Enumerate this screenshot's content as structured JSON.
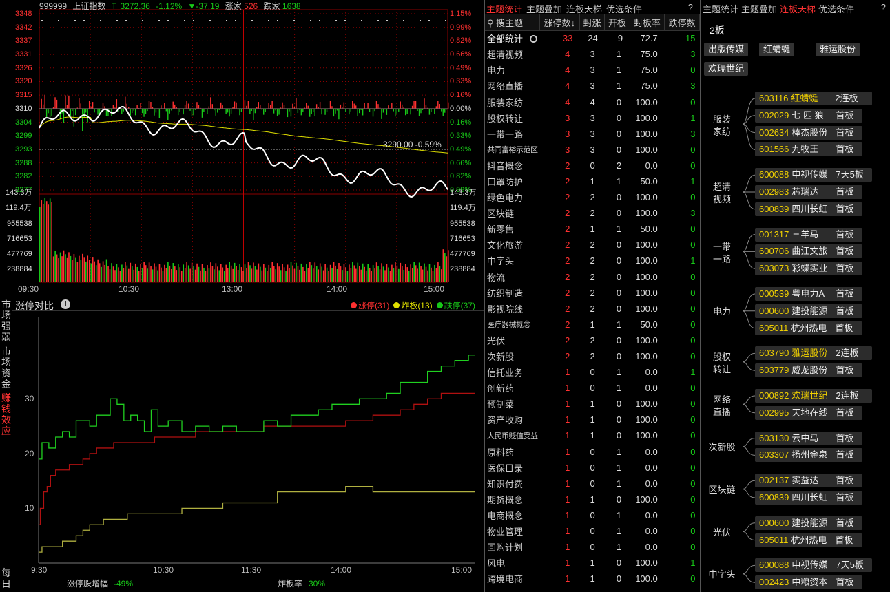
{
  "index": {
    "code": "999999",
    "name": "上证指数",
    "t": "T",
    "price": "3272.36",
    "pct": "-1.12%",
    "chg": "▼-37.19",
    "up_label": "涨家",
    "up": "526",
    "dn_label": "跌家",
    "dn": "1638",
    "left_prices": [
      "3348",
      "3342",
      "3337",
      "3331",
      "3326",
      "3320",
      "3315",
      "3310",
      "3304",
      "3299",
      "3293",
      "3288",
      "3282",
      "3277"
    ],
    "right_pcts": [
      "1.15%",
      "0.99%",
      "0.82%",
      "0.66%",
      "0.49%",
      "0.33%",
      "0.16%",
      "0.00%",
      "0.16%",
      "0.33%",
      "0.49%",
      "0.66%",
      "0.82%",
      "0.99%"
    ],
    "vol_labels": [
      "143.3万",
      "119.4万",
      "955538",
      "716653",
      "477769",
      "238884"
    ],
    "times": [
      "09:30",
      "10:30",
      "13:00",
      "14:00",
      "15:00"
    ],
    "cursor_label": "3290.00 -0.59%"
  },
  "breadth": {
    "side_tabs": [
      {
        "label": "市场强弱",
        "active": false
      },
      {
        "label": "市场资金",
        "active": false
      },
      {
        "label": "赚钱效应",
        "active": true
      },
      {
        "label": "每日",
        "active": false
      }
    ],
    "title": "涨停对比",
    "legend": [
      {
        "label": "涨停(31)",
        "color": "#ff3030"
      },
      {
        "label": "炸板(13)",
        "color": "#e0e000"
      },
      {
        "label": "跌停(37)",
        "color": "#18c818"
      }
    ],
    "yticks": [
      "30",
      "20",
      "10"
    ],
    "xticks": [
      "9:30",
      "10:30",
      "11:30",
      "14:00",
      "15:00"
    ],
    "foot1_label": "涨停股增幅",
    "foot1_val": "-49%",
    "foot2_label": "炸板率",
    "foot2_val": "30%"
  },
  "chart_data": {
    "type": "line",
    "xlabel": "",
    "ylabel": "",
    "ylim": [
      0,
      45
    ],
    "series": [
      {
        "name": "涨停(31)",
        "color": "#ff3030",
        "x": [
          0,
          5,
          10,
          15,
          20,
          30,
          40,
          50,
          60,
          70,
          80,
          90,
          100,
          120,
          140,
          160,
          180,
          200,
          220,
          240,
          260,
          280,
          300,
          320,
          340,
          360,
          380,
          400,
          420,
          440,
          460,
          480,
          500,
          520,
          540,
          560,
          580,
          600,
          620,
          640
        ],
        "values": [
          7,
          10,
          13,
          14,
          16,
          17,
          17,
          18,
          18,
          19,
          20,
          21,
          21,
          22,
          22,
          22,
          23,
          23,
          23,
          24,
          24,
          24,
          24,
          24,
          25,
          25,
          25,
          25,
          25,
          25,
          26,
          26,
          27,
          27,
          28,
          29,
          30,
          31,
          31,
          31
        ]
      },
      {
        "name": "炸板(13)",
        "color": "#e0e000",
        "x": [
          0,
          10,
          20,
          30,
          40,
          50,
          60,
          70,
          80,
          90,
          100,
          120,
          140,
          160,
          180,
          200,
          220,
          240,
          260,
          280,
          300,
          320,
          340,
          360,
          380,
          400,
          420,
          440,
          460,
          480,
          500,
          520,
          540,
          560,
          580,
          600,
          620,
          640
        ],
        "values": [
          2,
          3,
          3,
          3,
          4,
          4,
          5,
          6,
          7,
          7,
          8,
          8,
          9,
          9,
          9,
          9,
          10,
          10,
          10,
          11,
          11,
          11,
          11,
          13,
          13,
          13,
          13,
          13,
          14,
          14,
          13,
          13,
          13,
          13,
          13,
          13,
          13,
          13
        ]
      },
      {
        "name": "跌停(37)",
        "color": "#18c818",
        "x": [
          0,
          10,
          20,
          30,
          40,
          50,
          60,
          70,
          80,
          90,
          100,
          110,
          120,
          130,
          140,
          150,
          160,
          170,
          180,
          200,
          220,
          240,
          260,
          280,
          300,
          320,
          340,
          360,
          380,
          400,
          420,
          440,
          460,
          480,
          500,
          520,
          540,
          560,
          580,
          600,
          620,
          640
        ],
        "values": [
          19,
          22,
          21,
          23,
          24,
          23,
          26,
          26,
          25,
          27,
          27,
          30,
          29,
          26,
          27,
          26,
          24,
          28,
          25,
          26,
          24,
          25,
          24,
          25,
          24,
          24,
          26,
          25,
          27,
          27,
          28,
          29,
          29,
          30,
          30,
          31,
          33,
          33,
          35,
          36,
          37,
          38
        ]
      }
    ]
  },
  "themes": {
    "tabs": [
      {
        "label": "主题统计",
        "active": true
      },
      {
        "label": "主题叠加",
        "active": false
      },
      {
        "label": "连板天梯",
        "active": false
      },
      {
        "label": "优选条件",
        "active": false
      },
      {
        "label": "?",
        "active": false
      }
    ],
    "search": "搜主题",
    "cols": [
      "涨停数↓",
      "封涨",
      "开板",
      "封板率",
      "跌停数"
    ],
    "total": {
      "name": "全部统计",
      "a": "33",
      "b": "24",
      "c": "9",
      "d": "72.7",
      "e": "15"
    },
    "rows": [
      [
        "超清视频",
        "4",
        "3",
        "1",
        "75.0",
        "3"
      ],
      [
        "电力",
        "4",
        "3",
        "1",
        "75.0",
        "0"
      ],
      [
        "网络直播",
        "4",
        "3",
        "1",
        "75.0",
        "3"
      ],
      [
        "服装家纺",
        "4",
        "4",
        "0",
        "100.0",
        "0"
      ],
      [
        "股权转让",
        "3",
        "3",
        "0",
        "100.0",
        "1"
      ],
      [
        "一带一路",
        "3",
        "3",
        "0",
        "100.0",
        "3"
      ],
      [
        "共同富裕示范区",
        "3",
        "3",
        "0",
        "100.0",
        "0"
      ],
      [
        "抖音概念",
        "2",
        "0",
        "2",
        "0.0",
        "0"
      ],
      [
        "口罩防护",
        "2",
        "1",
        "1",
        "50.0",
        "1"
      ],
      [
        "绿色电力",
        "2",
        "2",
        "0",
        "100.0",
        "0"
      ],
      [
        "区块链",
        "2",
        "2",
        "0",
        "100.0",
        "3"
      ],
      [
        "新零售",
        "2",
        "1",
        "1",
        "50.0",
        "0"
      ],
      [
        "文化旅游",
        "2",
        "2",
        "0",
        "100.0",
        "0"
      ],
      [
        "中字头",
        "2",
        "2",
        "0",
        "100.0",
        "1"
      ],
      [
        "物流",
        "2",
        "2",
        "0",
        "100.0",
        "0"
      ],
      [
        "纺织制造",
        "2",
        "2",
        "0",
        "100.0",
        "0"
      ],
      [
        "影视院线",
        "2",
        "2",
        "0",
        "100.0",
        "0"
      ],
      [
        "医疗器械概念",
        "2",
        "1",
        "1",
        "50.0",
        "0"
      ],
      [
        "光伏",
        "2",
        "2",
        "0",
        "100.0",
        "0"
      ],
      [
        "次新股",
        "2",
        "2",
        "0",
        "100.0",
        "0"
      ],
      [
        "信托业务",
        "1",
        "0",
        "1",
        "0.0",
        "1"
      ],
      [
        "创新药",
        "1",
        "0",
        "1",
        "0.0",
        "0"
      ],
      [
        "预制菜",
        "1",
        "1",
        "0",
        "100.0",
        "0"
      ],
      [
        "资产收购",
        "1",
        "1",
        "0",
        "100.0",
        "0"
      ],
      [
        "人民币贬值受益",
        "1",
        "1",
        "0",
        "100.0",
        "0"
      ],
      [
        "原料药",
        "1",
        "0",
        "1",
        "0.0",
        "0"
      ],
      [
        "医保目录",
        "1",
        "0",
        "1",
        "0.0",
        "0"
      ],
      [
        "知识付费",
        "1",
        "0",
        "1",
        "0.0",
        "0"
      ],
      [
        "期货概念",
        "1",
        "1",
        "0",
        "100.0",
        "0"
      ],
      [
        "电商概念",
        "1",
        "0",
        "1",
        "0.0",
        "0"
      ],
      [
        "物业管理",
        "1",
        "0",
        "1",
        "0.0",
        "0"
      ],
      [
        "回购计划",
        "1",
        "0",
        "1",
        "0.0",
        "0"
      ],
      [
        "风电",
        "1",
        "1",
        "0",
        "100.0",
        "1"
      ],
      [
        "跨境电商",
        "1",
        "1",
        "0",
        "100.0",
        "0"
      ]
    ]
  },
  "ladder": {
    "tabs": [
      {
        "label": "主题统计",
        "active": false
      },
      {
        "label": "主题叠加",
        "active": false
      },
      {
        "label": "连板天梯",
        "active": true
      },
      {
        "label": "优选条件",
        "active": false
      },
      {
        "label": "?",
        "active": false
      }
    ],
    "level": "2板",
    "top": [
      "出版传媒",
      "红蜻蜓",
      "雅运股份",
      "欢瑞世纪"
    ],
    "groups": [
      {
        "sector": "服装家纺",
        "stocks": [
          {
            "code": "603116",
            "name": "红蜻蜓",
            "board": "2连板",
            "hl": true
          },
          {
            "code": "002029",
            "name": "七 匹 狼",
            "board": "首板",
            "hl": false
          },
          {
            "code": "002634",
            "name": "棒杰股份",
            "board": "首板",
            "hl": false
          },
          {
            "code": "601566",
            "name": "九牧王",
            "board": "首板",
            "hl": false
          }
        ]
      },
      {
        "sector": "超清视频",
        "stocks": [
          {
            "code": "600088",
            "name": "中视传媒",
            "board": "7天5板",
            "hl": false
          },
          {
            "code": "002983",
            "name": "芯瑞达",
            "board": "首板",
            "hl": false
          },
          {
            "code": "600839",
            "name": "四川长虹",
            "board": "首板",
            "hl": false
          }
        ]
      },
      {
        "sector": "一带一路",
        "stocks": [
          {
            "code": "001317",
            "name": "三羊马",
            "board": "首板",
            "hl": false
          },
          {
            "code": "600706",
            "name": "曲江文旅",
            "board": "首板",
            "hl": false
          },
          {
            "code": "603073",
            "name": "彩蝶实业",
            "board": "首板",
            "hl": false
          }
        ]
      },
      {
        "sector": "电力",
        "stocks": [
          {
            "code": "000539",
            "name": "粤电力A",
            "board": "首板",
            "hl": false
          },
          {
            "code": "000600",
            "name": "建投能源",
            "board": "首板",
            "hl": false
          },
          {
            "code": "605011",
            "name": "杭州热电",
            "board": "首板",
            "hl": false
          }
        ]
      },
      {
        "sector": "股权转让",
        "stocks": [
          {
            "code": "603790",
            "name": "雅运股份",
            "board": "2连板",
            "hl": true
          },
          {
            "code": "603779",
            "name": "威龙股份",
            "board": "首板",
            "hl": false
          }
        ]
      },
      {
        "sector": "网络直播",
        "stocks": [
          {
            "code": "000892",
            "name": "欢瑞世纪",
            "board": "2连板",
            "hl": true
          },
          {
            "code": "002995",
            "name": "天地在线",
            "board": "首板",
            "hl": false
          }
        ]
      },
      {
        "sector": "次新股",
        "stocks": [
          {
            "code": "603130",
            "name": "云中马",
            "board": "首板",
            "hl": false
          },
          {
            "code": "603307",
            "name": "扬州金泉",
            "board": "首板",
            "hl": false
          }
        ]
      },
      {
        "sector": "区块链",
        "stocks": [
          {
            "code": "002137",
            "name": "实益达",
            "board": "首板",
            "hl": false
          },
          {
            "code": "600839",
            "name": "四川长虹",
            "board": "首板",
            "hl": false
          }
        ]
      },
      {
        "sector": "光伏",
        "stocks": [
          {
            "code": "000600",
            "name": "建投能源",
            "board": "首板",
            "hl": false
          },
          {
            "code": "605011",
            "name": "杭州热电",
            "board": "首板",
            "hl": false
          }
        ]
      },
      {
        "sector": "中字头",
        "stocks": [
          {
            "code": "600088",
            "name": "中视传媒",
            "board": "7天5板",
            "hl": false
          },
          {
            "code": "002423",
            "name": "中粮资本",
            "board": "首板",
            "hl": false
          }
        ]
      }
    ]
  },
  "colors": {
    "up": "#ff3030",
    "down": "#18c818",
    "flat": "#e0e000",
    "grid": "#8b0000",
    "white": "#ffffff"
  }
}
